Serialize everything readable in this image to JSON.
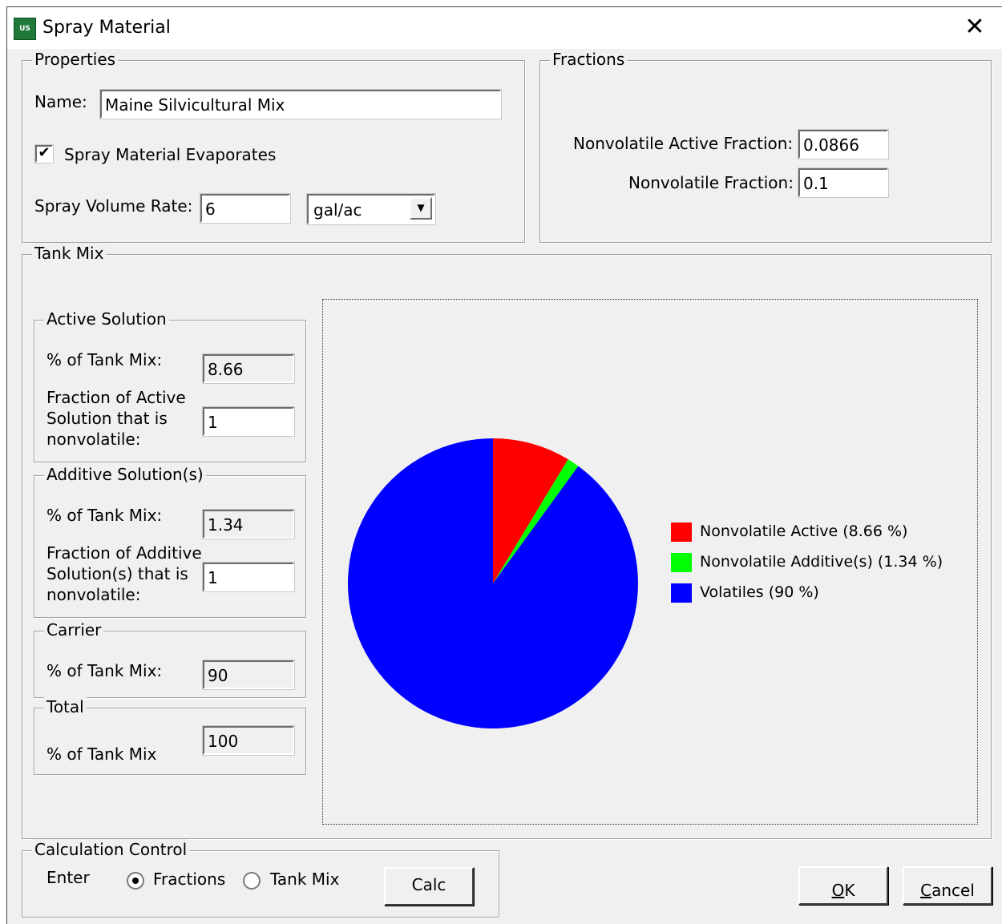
{
  "window": {
    "title": "Spray Material",
    "icon": "usfs-shield-icon",
    "close_glyph": "✕"
  },
  "app_icon_text": "US",
  "properties": {
    "group_label": "Properties",
    "name_label": "Name:",
    "name_value": "Maine Silvicultural Mix",
    "evaporates_label": "Spray Material Evaporates",
    "evaporates_checked": true,
    "check_glyph": "✔",
    "volume_rate_label": "Spray Volume Rate:",
    "volume_rate_value": "6",
    "volume_unit": "gal/ac",
    "dropdown_glyph": "▼"
  },
  "fractions": {
    "group_label": "Fractions",
    "active_label": "Nonvolatile Active Fraction:",
    "active_value": "0.0866",
    "nonvolatile_label": "Nonvolatile Fraction:",
    "nonvolatile_value": "0.1"
  },
  "tank_mix": {
    "group_label": "Tank Mix",
    "active": {
      "group_label": "Active Solution",
      "pct_label": "% of Tank Mix:",
      "pct_value": "8.66",
      "fraction_label_1": "Fraction of Active",
      "fraction_label_2": "Solution that is",
      "fraction_label_3": "nonvolatile:",
      "fraction_value": "1"
    },
    "additive": {
      "group_label": "Additive Solution(s)",
      "pct_label": "% of Tank Mix:",
      "pct_value": "1.34",
      "fraction_label_1": "Fraction of Additive",
      "fraction_label_2": "Solution(s) that is",
      "fraction_label_3": "nonvolatile:",
      "fraction_value": "1"
    },
    "carrier": {
      "group_label": "Carrier",
      "pct_label": "% of Tank Mix:",
      "pct_value": "90"
    },
    "total": {
      "group_label": "Total",
      "pct_label": "% of Tank Mix",
      "pct_value": "100"
    }
  },
  "chart_data": {
    "type": "pie",
    "categories": [
      "Nonvolatile Active (8.66 %)",
      "Nonvolatile Additive(s) (1.34 %)",
      "Volatiles (90 %)"
    ],
    "values": [
      8.66,
      1.34,
      90
    ],
    "colors": [
      "#ff0000",
      "#00ff00",
      "#0000ff"
    ],
    "legend_position": "right"
  },
  "calc_control": {
    "group_label": "Calculation Control",
    "enter_label": "Enter",
    "radio_fractions_label": "Fractions",
    "radio_tankmix_label": "Tank Mix",
    "selected": "Fractions",
    "calc_button": "Calc"
  },
  "buttons": {
    "ok_accel": "O",
    "ok_rest": "K",
    "cancel_accel": "C",
    "cancel_rest": "ancel"
  }
}
